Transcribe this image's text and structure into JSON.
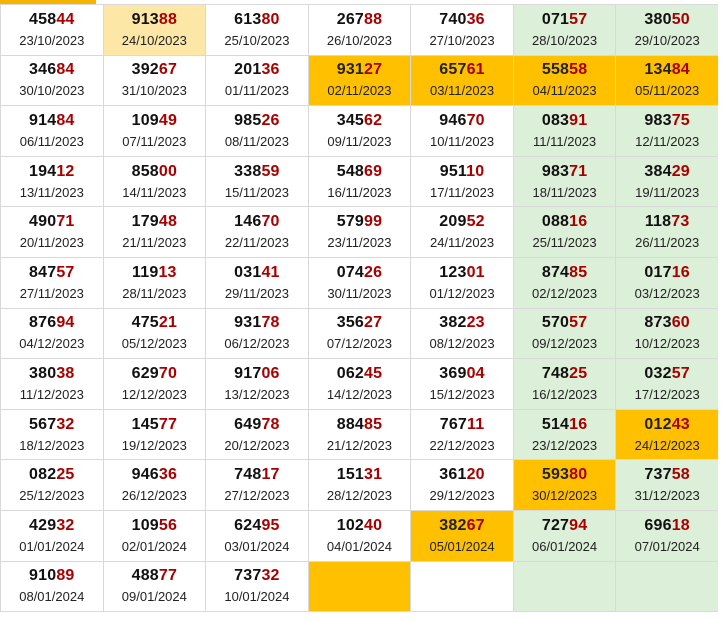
{
  "table": {
    "rows": [
      [
        {
          "num": "45844",
          "date": "23/10/2023",
          "bg": ""
        },
        {
          "num": "91388",
          "date": "24/10/2023",
          "bg": "pale"
        },
        {
          "num": "61380",
          "date": "25/10/2023",
          "bg": ""
        },
        {
          "num": "26788",
          "date": "26/10/2023",
          "bg": ""
        },
        {
          "num": "74036",
          "date": "27/10/2023",
          "bg": ""
        },
        {
          "num": "07157",
          "date": "28/10/2023",
          "bg": "green"
        },
        {
          "num": "38050",
          "date": "29/10/2023",
          "bg": "green"
        }
      ],
      [
        {
          "num": "34684",
          "date": "30/10/2023",
          "bg": ""
        },
        {
          "num": "39267",
          "date": "31/10/2023",
          "bg": ""
        },
        {
          "num": "20136",
          "date": "01/11/2023",
          "bg": ""
        },
        {
          "num": "93127",
          "date": "02/11/2023",
          "bg": "orange"
        },
        {
          "num": "65761",
          "date": "03/11/2023",
          "bg": "orange"
        },
        {
          "num": "55858",
          "date": "04/11/2023",
          "bg": "orange"
        },
        {
          "num": "13484",
          "date": "05/11/2023",
          "bg": "orange"
        }
      ],
      [
        {
          "num": "91484",
          "date": "06/11/2023",
          "bg": ""
        },
        {
          "num": "10949",
          "date": "07/11/2023",
          "bg": ""
        },
        {
          "num": "98526",
          "date": "08/11/2023",
          "bg": ""
        },
        {
          "num": "34562",
          "date": "09/11/2023",
          "bg": ""
        },
        {
          "num": "94670",
          "date": "10/11/2023",
          "bg": ""
        },
        {
          "num": "08391",
          "date": "11/11/2023",
          "bg": "green"
        },
        {
          "num": "98375",
          "date": "12/11/2023",
          "bg": "green"
        }
      ],
      [
        {
          "num": "19412",
          "date": "13/11/2023",
          "bg": ""
        },
        {
          "num": "85800",
          "date": "14/11/2023",
          "bg": ""
        },
        {
          "num": "33859",
          "date": "15/11/2023",
          "bg": ""
        },
        {
          "num": "54869",
          "date": "16/11/2023",
          "bg": ""
        },
        {
          "num": "95110",
          "date": "17/11/2023",
          "bg": ""
        },
        {
          "num": "98371",
          "date": "18/11/2023",
          "bg": "green"
        },
        {
          "num": "38429",
          "date": "19/11/2023",
          "bg": "green"
        }
      ],
      [
        {
          "num": "49071",
          "date": "20/11/2023",
          "bg": ""
        },
        {
          "num": "17948",
          "date": "21/11/2023",
          "bg": ""
        },
        {
          "num": "14670",
          "date": "22/11/2023",
          "bg": ""
        },
        {
          "num": "57999",
          "date": "23/11/2023",
          "bg": ""
        },
        {
          "num": "20952",
          "date": "24/11/2023",
          "bg": ""
        },
        {
          "num": "08816",
          "date": "25/11/2023",
          "bg": "green"
        },
        {
          "num": "11873",
          "date": "26/11/2023",
          "bg": "green"
        }
      ],
      [
        {
          "num": "84757",
          "date": "27/11/2023",
          "bg": ""
        },
        {
          "num": "11913",
          "date": "28/11/2023",
          "bg": ""
        },
        {
          "num": "03141",
          "date": "29/11/2023",
          "bg": ""
        },
        {
          "num": "07426",
          "date": "30/11/2023",
          "bg": ""
        },
        {
          "num": "12301",
          "date": "01/12/2023",
          "bg": ""
        },
        {
          "num": "87485",
          "date": "02/12/2023",
          "bg": "green"
        },
        {
          "num": "01716",
          "date": "03/12/2023",
          "bg": "green"
        }
      ],
      [
        {
          "num": "87694",
          "date": "04/12/2023",
          "bg": ""
        },
        {
          "num": "47521",
          "date": "05/12/2023",
          "bg": ""
        },
        {
          "num": "93178",
          "date": "06/12/2023",
          "bg": ""
        },
        {
          "num": "35627",
          "date": "07/12/2023",
          "bg": ""
        },
        {
          "num": "38223",
          "date": "08/12/2023",
          "bg": ""
        },
        {
          "num": "57057",
          "date": "09/12/2023",
          "bg": "green"
        },
        {
          "num": "87360",
          "date": "10/12/2023",
          "bg": "green"
        }
      ],
      [
        {
          "num": "38038",
          "date": "11/12/2023",
          "bg": ""
        },
        {
          "num": "62970",
          "date": "12/12/2023",
          "bg": ""
        },
        {
          "num": "91706",
          "date": "13/12/2023",
          "bg": ""
        },
        {
          "num": "06245",
          "date": "14/12/2023",
          "bg": ""
        },
        {
          "num": "36904",
          "date": "15/12/2023",
          "bg": ""
        },
        {
          "num": "74825",
          "date": "16/12/2023",
          "bg": "green"
        },
        {
          "num": "03257",
          "date": "17/12/2023",
          "bg": "green"
        }
      ],
      [
        {
          "num": "56732",
          "date": "18/12/2023",
          "bg": ""
        },
        {
          "num": "14577",
          "date": "19/12/2023",
          "bg": ""
        },
        {
          "num": "64978",
          "date": "20/12/2023",
          "bg": ""
        },
        {
          "num": "88485",
          "date": "21/12/2023",
          "bg": ""
        },
        {
          "num": "76711",
          "date": "22/12/2023",
          "bg": ""
        },
        {
          "num": "51416",
          "date": "23/12/2023",
          "bg": "green"
        },
        {
          "num": "01243",
          "date": "24/12/2023",
          "bg": "orange"
        }
      ],
      [
        {
          "num": "08225",
          "date": "25/12/2023",
          "bg": ""
        },
        {
          "num": "94636",
          "date": "26/12/2023",
          "bg": ""
        },
        {
          "num": "74817",
          "date": "27/12/2023",
          "bg": ""
        },
        {
          "num": "15131",
          "date": "28/12/2023",
          "bg": ""
        },
        {
          "num": "36120",
          "date": "29/12/2023",
          "bg": ""
        },
        {
          "num": "59380",
          "date": "30/12/2023",
          "bg": "orange"
        },
        {
          "num": "73758",
          "date": "31/12/2023",
          "bg": "green"
        }
      ],
      [
        {
          "num": "42932",
          "date": "01/01/2024",
          "bg": ""
        },
        {
          "num": "10956",
          "date": "02/01/2024",
          "bg": ""
        },
        {
          "num": "62495",
          "date": "03/01/2024",
          "bg": ""
        },
        {
          "num": "10240",
          "date": "04/01/2024",
          "bg": ""
        },
        {
          "num": "38267",
          "date": "05/01/2024",
          "bg": "orange"
        },
        {
          "num": "72794",
          "date": "06/01/2024",
          "bg": "green"
        },
        {
          "num": "69618",
          "date": "07/01/2024",
          "bg": "green"
        }
      ],
      [
        {
          "num": "91089",
          "date": "08/01/2024",
          "bg": ""
        },
        {
          "num": "48877",
          "date": "09/01/2024",
          "bg": ""
        },
        {
          "num": "73732",
          "date": "10/01/2024",
          "bg": ""
        },
        {
          "num": "",
          "date": "",
          "bg": "orange"
        },
        {
          "num": "",
          "date": "",
          "bg": ""
        },
        {
          "num": "",
          "date": "",
          "bg": "green"
        },
        {
          "num": "",
          "date": "",
          "bg": "green"
        }
      ]
    ]
  },
  "colors": {
    "highlight_digits": "#a80000",
    "weekend_green": "#dcefd8",
    "marked_orange": "#ffc000",
    "pale_yellow": "#fde7a7"
  }
}
